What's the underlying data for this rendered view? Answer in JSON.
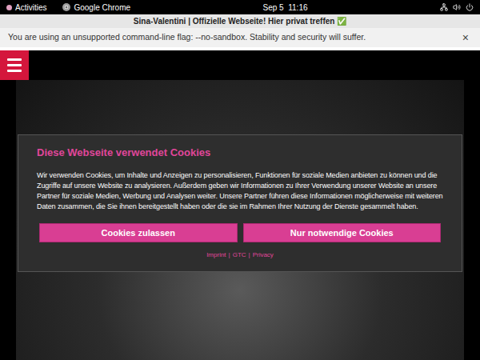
{
  "topbar": {
    "activities": "Activities",
    "app": "Google Chrome",
    "clock": "Sep 5  11:16"
  },
  "window": {
    "title": "Sina-Valentini | Offizielle Webseite! Hier privat treffen ✅"
  },
  "infobar": {
    "message": "You are using an unsupported command-line flag: --no-sandbox. Stability and security will suffer.",
    "close": "×"
  },
  "cookie_dialog": {
    "title": "Diese Webseite verwendet Cookies",
    "body": "Wir verwenden Cookies, um Inhalte und Anzeigen zu personalisieren, Funktionen für soziale Medien anbieten zu können und die Zugriffe auf unsere Website zu analysieren. Außerdem geben wir Informationen zu Ihrer Verwendung unserer Website an unsere Partner für soziale Medien, Werbung und Analysen weiter. Unsere Partner führen diese Informationen möglicherweise mit weiteren Daten zusammen, die Sie ihnen bereitgestellt haben oder die sie im Rahmen Ihrer Nutzung der Dienste gesammelt haben.",
    "buttons": [
      "Cookies zulassen",
      "Nur notwendige Cookies"
    ],
    "links": [
      "Imprint",
      "GTC",
      "Privacy"
    ],
    "separator": "|"
  }
}
